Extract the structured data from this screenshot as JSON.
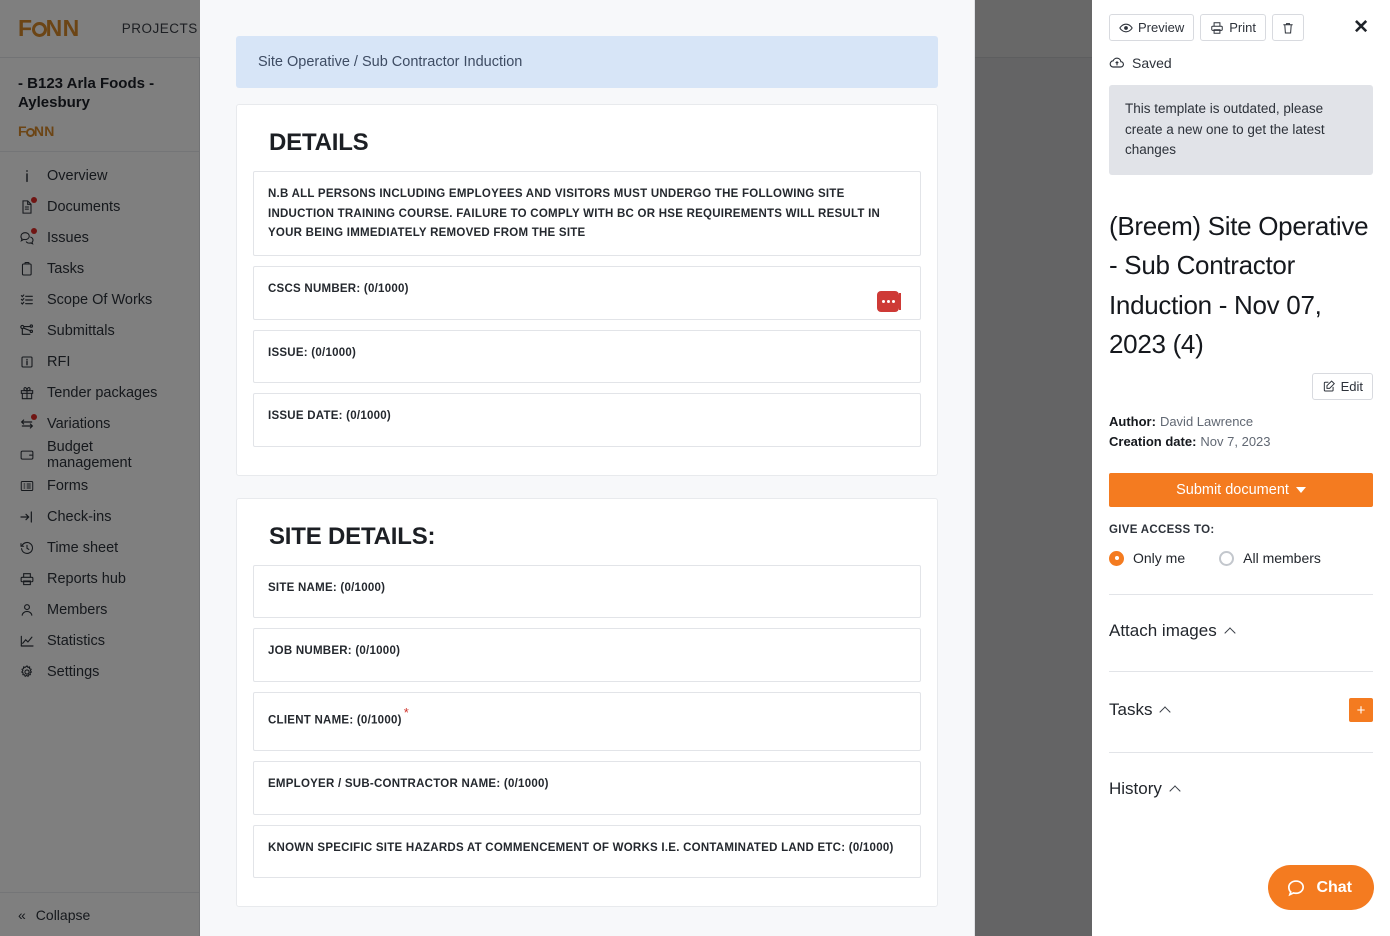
{
  "topbar": {
    "logo": "FONN",
    "breadcrumb": [
      "PROJECTS",
      "- B123 Arla Foods - Aylesbury"
    ],
    "separator": ">"
  },
  "sidebar": {
    "project_name": "- B123 Arla Foods - Aylesbury",
    "project_logo": "FONN",
    "items": [
      {
        "label": "Overview",
        "icon": "info-icon",
        "badge": false
      },
      {
        "label": "Documents",
        "icon": "document-icon",
        "badge": true
      },
      {
        "label": "Issues",
        "icon": "chat-bubbles-icon",
        "badge": true
      },
      {
        "label": "Tasks",
        "icon": "clipboard-icon",
        "badge": false
      },
      {
        "label": "Scope Of Works",
        "icon": "checklist-icon",
        "badge": false
      },
      {
        "label": "Submittals",
        "icon": "branch-icon",
        "badge": false
      },
      {
        "label": "RFI",
        "icon": "info-square-icon",
        "badge": false
      },
      {
        "label": "Tender packages",
        "icon": "gift-icon",
        "badge": false
      },
      {
        "label": "Variations",
        "icon": "exchange-arrows-icon",
        "badge": true
      },
      {
        "label": "Budget management",
        "icon": "wallet-icon",
        "badge": false
      },
      {
        "label": "Forms",
        "icon": "form-list-icon",
        "badge": false
      },
      {
        "label": "Check-ins",
        "icon": "login-arrow-icon",
        "badge": false
      },
      {
        "label": "Time sheet",
        "icon": "clock-history-icon",
        "badge": false
      },
      {
        "label": "Reports hub",
        "icon": "printer-icon",
        "badge": false
      },
      {
        "label": "Members",
        "icon": "person-icon",
        "badge": false
      },
      {
        "label": "Statistics",
        "icon": "chart-line-icon",
        "badge": false
      },
      {
        "label": "Settings",
        "icon": "gear-icon",
        "badge": false
      }
    ],
    "collapse_label": "Collapse"
  },
  "document": {
    "banner": "Site Operative / Sub Contractor Induction",
    "sections": [
      {
        "title": "DETAILS",
        "fields": [
          {
            "label": "N.B ALL PERSONS INCLUDING EMPLOYEES AND VISITORS MUST UNDERGO THE FOLLOWING SITE INDUCTION TRAINING COURSE. FAILURE TO COMPLY WITH BC OR HSE REQUIREMENTS WILL RESULT IN YOUR BEING IMMEDIATELY REMOVED FROM THE SITE",
            "type": "intro",
            "required": false,
            "badge": false
          },
          {
            "label": "CSCS NUMBER: (0/1000)",
            "type": "text",
            "required": false,
            "badge": true
          },
          {
            "label": "ISSUE: (0/1000)",
            "type": "text",
            "required": false,
            "badge": false
          },
          {
            "label": "ISSUE DATE: (0/1000)",
            "type": "text",
            "required": false,
            "badge": false
          }
        ]
      },
      {
        "title": "SITE DETAILS:",
        "fields": [
          {
            "label": "SITE NAME: (0/1000)",
            "type": "text",
            "required": false,
            "badge": false
          },
          {
            "label": "JOB NUMBER: (0/1000)",
            "type": "text",
            "required": false,
            "badge": false
          },
          {
            "label": "CLIENT NAME: (0/1000)",
            "type": "text",
            "required": true,
            "badge": false
          },
          {
            "label": "EMPLOYER / SUB-CONTRACTOR NAME: (0/1000)",
            "type": "text",
            "required": false,
            "badge": false
          },
          {
            "label": "KNOWN SPECIFIC SITE HAZARDS AT COMMENCEMENT OF WORKS I.E. CONTAMINATED LAND ETC: (0/1000)",
            "type": "text",
            "required": false,
            "badge": false
          }
        ]
      }
    ]
  },
  "panel": {
    "preview_label": "Preview",
    "print_label": "Print",
    "delete_label": "",
    "close_label": "✕",
    "saved_label": "Saved",
    "notice": "This template is outdated, please create a new one to get the latest changes",
    "title": "(Breem) Site Operative - Sub Contractor Induction - Nov 07, 2023 (4)",
    "edit_label": "Edit",
    "author_key": "Author:",
    "author_value": "David Lawrence",
    "creation_key": "Creation date:",
    "creation_value": "Nov 7, 2023",
    "submit_label": "Submit document",
    "access_label": "GIVE ACCESS TO:",
    "access_options": [
      {
        "label": "Only me",
        "selected": true
      },
      {
        "label": "All members",
        "selected": false
      }
    ],
    "accordions": [
      {
        "label": "Attach images",
        "has_add": false,
        "add_label": ""
      },
      {
        "label": "Tasks",
        "has_add": true,
        "add_label": "+"
      },
      {
        "label": "History",
        "has_add": false,
        "add_label": ""
      }
    ]
  },
  "chat": {
    "label": "Chat"
  },
  "colors": {
    "accent": "#f47b20",
    "brand": "#d98a2b",
    "banner_bg": "#d7e5f7",
    "notice_bg": "#e1e3e8",
    "badge_red": "#ce3a36",
    "required_red": "#d0342c"
  }
}
